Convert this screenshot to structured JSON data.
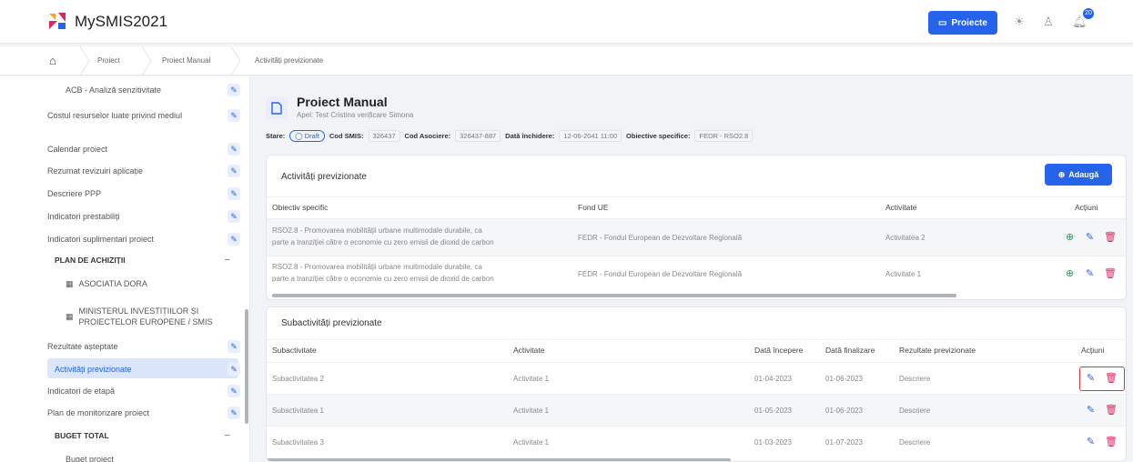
{
  "app": {
    "title": "MySMIS2021"
  },
  "topbar": {
    "projects_button": "Proiecte",
    "notification_count": "20"
  },
  "breadcrumb": [
    "Proiect",
    "Proiect Manual",
    "Activități previzionate"
  ],
  "sidebar": {
    "items": [
      {
        "label": "ACB - Analiză senzitivitate"
      },
      {
        "label": "Costul resurselor luate privind mediul"
      },
      {
        "label": "Calendar proiect"
      },
      {
        "label": "Rezumat revizuiri aplicație"
      },
      {
        "label": "Descriere PPP"
      },
      {
        "label": "Indicatori prestabiliți"
      },
      {
        "label": "Indicatori suplimentari proiect"
      }
    ],
    "section_achizitii": "PLAN DE ACHIZIȚII",
    "achizitii_items": [
      {
        "label": "ASOCIATIA DORA"
      },
      {
        "label": "MINISTERUL INVESTIȚIILOR ȘI PROIECTELOR EUROPENE / SMIS"
      }
    ],
    "items2": [
      {
        "label": "Rezultate așteptate"
      },
      {
        "label": "Activități previzionate"
      },
      {
        "label": "Indicatori de etapă"
      },
      {
        "label": "Plan de monitorizare proiect"
      }
    ],
    "section_buget": "BUGET TOTAL",
    "buget_items": [
      {
        "label": "Buget proiect"
      }
    ]
  },
  "project": {
    "title": "Proiect Manual",
    "subtitle": "Apel: Test Cristina verificare Simona",
    "meta": {
      "stare_label": "Stare:",
      "stare_value": "Draft",
      "cod_smis_label": "Cod SMIS:",
      "cod_smis_value": "326437",
      "cod_asociere_label": "Cod Asociere:",
      "cod_asociere_value": "326437-887",
      "data_inchidere_label": "Dată închidere:",
      "data_inchidere_value": "12-06-2041 11:00",
      "obiective_label": "Obiective specifice:",
      "obiective_value": "FEDR - RSO2.8"
    }
  },
  "activitati": {
    "title": "Activități previzionate",
    "add_button": "Adaugă",
    "columns": [
      "Obiectiv specific",
      "Fond UE",
      "Activitate",
      "Acțiuni"
    ],
    "rows": [
      {
        "obiectiv_l1": "RSO2.8 - Promovarea mobilității urbane multimodale durabile, ca",
        "obiectiv_l2": "parte a tranziției către o economie cu zero emisii de dioxid de carbon",
        "fond": "FEDR - Fondul European de Dezvoltare Regională",
        "activitate": "Activitatea 2"
      },
      {
        "obiectiv_l1": "RSO2.8 - Promovarea mobilității urbane multimodale durabile, ca",
        "obiectiv_l2": "parte a tranziției către o economie cu zero emisii de dioxid de carbon",
        "fond": "FEDR - Fondul European de Dezvoltare Regională",
        "activitate": "Activitate 1"
      }
    ]
  },
  "subactivitati": {
    "title": "Subactivități previzionate",
    "columns": [
      "Subactivitate",
      "Activitate",
      "Dată începere",
      "Dată finalizare",
      "Rezultate previzionate",
      "Acțiuni"
    ],
    "rows": [
      {
        "sub": "Subactivitatea 2",
        "act": "Activitate 1",
        "start": "01-04-2023",
        "end": "01-06-2023",
        "rez": "Descriere"
      },
      {
        "sub": "Subactivitatea 1",
        "act": "Activitate 1",
        "start": "01-05-2023",
        "end": "01-06-2023",
        "rez": "Descriere"
      },
      {
        "sub": "Subactivitatea 3",
        "act": "Activitate 1",
        "start": "01-03-2023",
        "end": "01-07-2023",
        "rez": "Descriere"
      }
    ]
  },
  "colors": {
    "accent": "#2563eb",
    "danger": "#e0245e",
    "success": "#22a55a"
  }
}
